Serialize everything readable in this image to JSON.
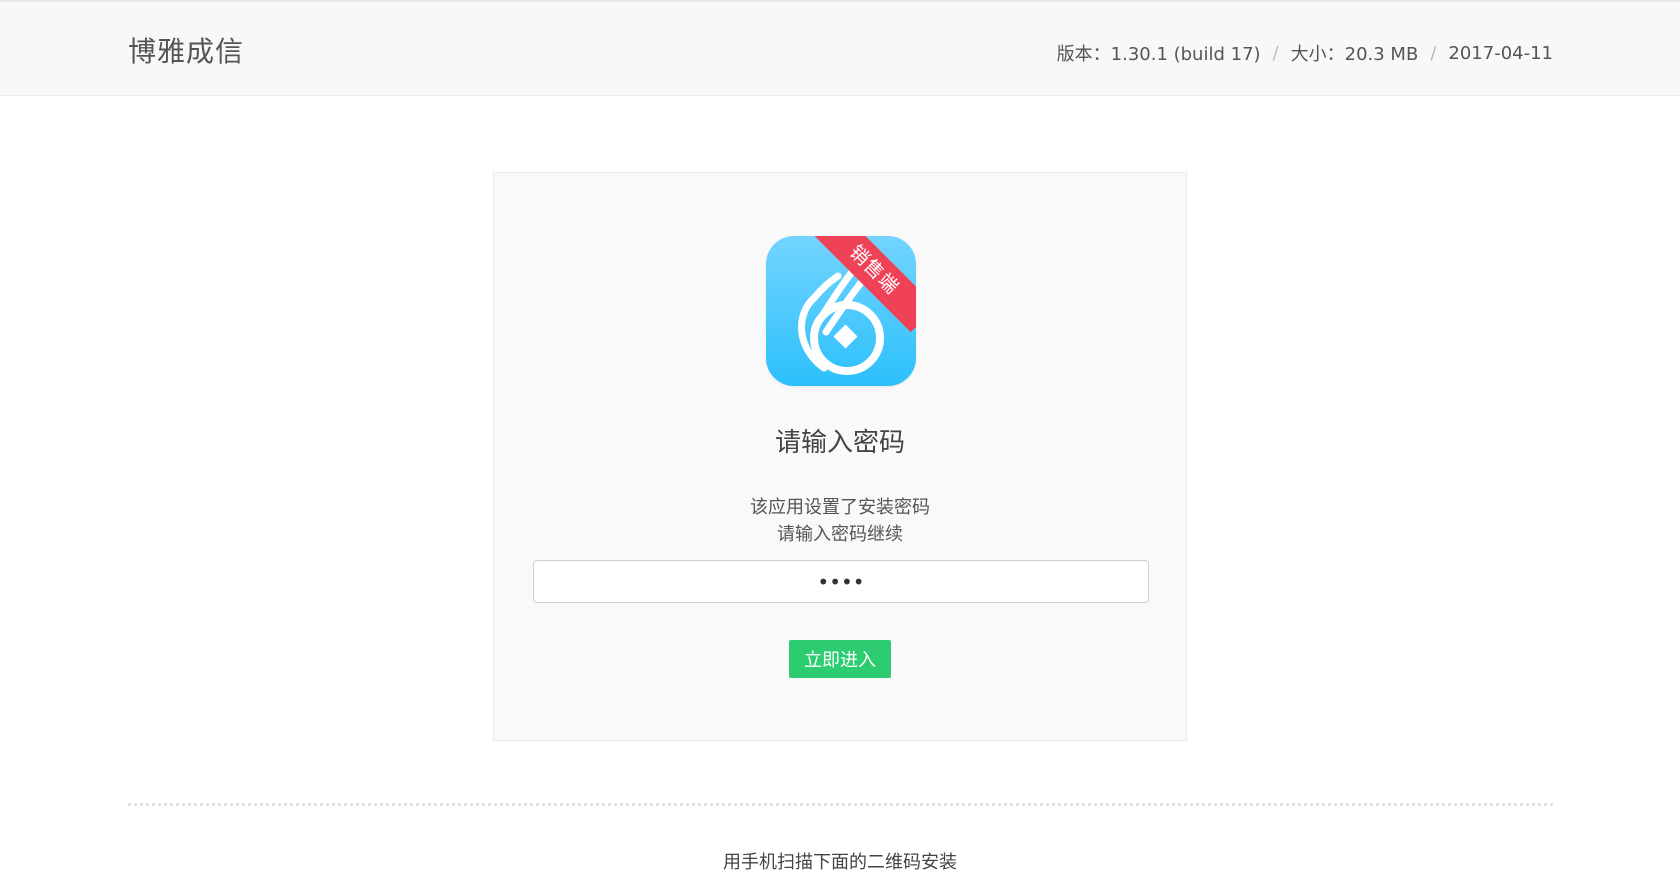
{
  "header": {
    "app_name": "博雅成信",
    "version": "版本：1.30.1 (build 17)",
    "size": "大小：20.3 MB",
    "date": "2017-04-11",
    "separator": "/"
  },
  "card": {
    "icon": {
      "name": "app-logo-icon",
      "badge_text": "销售端",
      "gradient": [
        "#73d4ff",
        "#2cc0fb"
      ],
      "badge_color": "#ef4257"
    },
    "title": "请输入密码",
    "description_line1": "该应用设置了安装密码",
    "description_line2": "请输入密码继续",
    "password_value": "••••",
    "submit_label": "立即进入",
    "submit_color": "#2ecc71"
  },
  "footer": {
    "qr_hint": "用手机扫描下面的二维码安装"
  }
}
